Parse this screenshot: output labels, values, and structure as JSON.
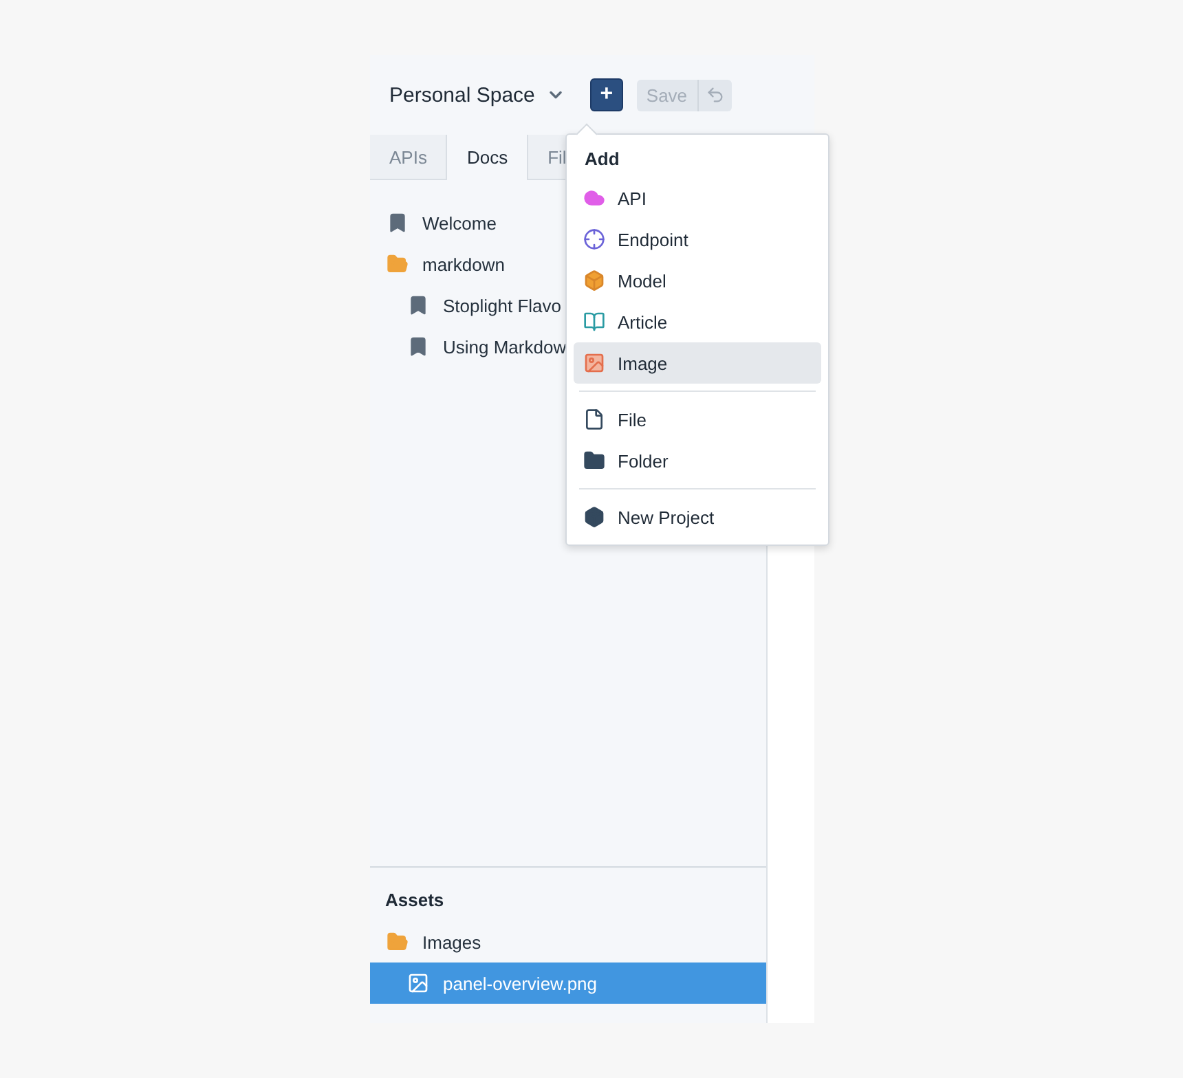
{
  "workspace": {
    "title": "Personal Space"
  },
  "toolbar": {
    "add_label": "+",
    "save_label": "Save",
    "save_disabled": true
  },
  "tabs": [
    {
      "label": "APIs",
      "selected": false
    },
    {
      "label": "Docs",
      "selected": true
    },
    {
      "label": "Fil",
      "selected": false
    }
  ],
  "tree": [
    {
      "kind": "doc",
      "label": "Welcome",
      "selected": false
    },
    {
      "kind": "folder",
      "label": "markdown",
      "selected": false,
      "expanded": true,
      "children": [
        {
          "kind": "doc",
          "label": "Stoplight Flavo",
          "selected": false
        },
        {
          "kind": "doc",
          "label": "Using Markdow",
          "selected": false
        }
      ]
    }
  ],
  "assets": {
    "title": "Assets",
    "tree": [
      {
        "kind": "folder",
        "label": "Images",
        "selected": false,
        "expanded": true,
        "children": [
          {
            "kind": "image",
            "label": "panel-overview.png",
            "selected": true
          }
        ]
      }
    ]
  },
  "add_menu": {
    "title": "Add",
    "groups": [
      [
        {
          "kind": "api",
          "label": "API",
          "highlighted": false
        },
        {
          "kind": "endpoint",
          "label": "Endpoint",
          "highlighted": false
        },
        {
          "kind": "model",
          "label": "Model",
          "highlighted": false
        },
        {
          "kind": "article",
          "label": "Article",
          "highlighted": false
        },
        {
          "kind": "image",
          "label": "Image",
          "highlighted": true
        }
      ],
      [
        {
          "kind": "file",
          "label": "File",
          "highlighted": false
        },
        {
          "kind": "folder",
          "label": "Folder",
          "highlighted": false
        }
      ],
      [
        {
          "kind": "project",
          "label": "New Project",
          "highlighted": false
        }
      ]
    ]
  }
}
